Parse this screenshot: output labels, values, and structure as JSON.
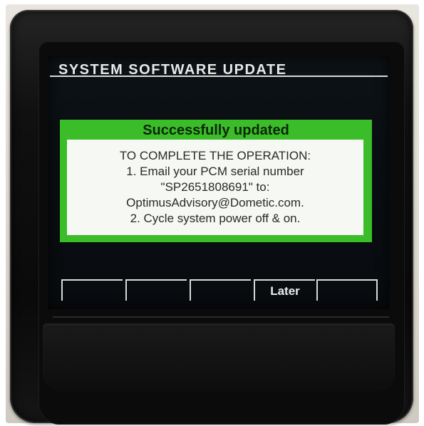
{
  "screen": {
    "title": "SYSTEM SOFTWARE UPDATE"
  },
  "dialog": {
    "header": "Successfully updated",
    "lines": [
      "TO COMPLETE THE OPERATION:",
      "1. Email your PCM serial number",
      "\"SP2651808691\" to:",
      "OptimusAdvisory@Dometic.com.",
      "2. Cycle system power off & on."
    ]
  },
  "softkeys": [
    "",
    "",
    "",
    "Later",
    ""
  ],
  "colors": {
    "dialog_header_green": "#3bbd2a",
    "lcd_background": "#0a0e12",
    "bezel": "#0a0a0a"
  }
}
